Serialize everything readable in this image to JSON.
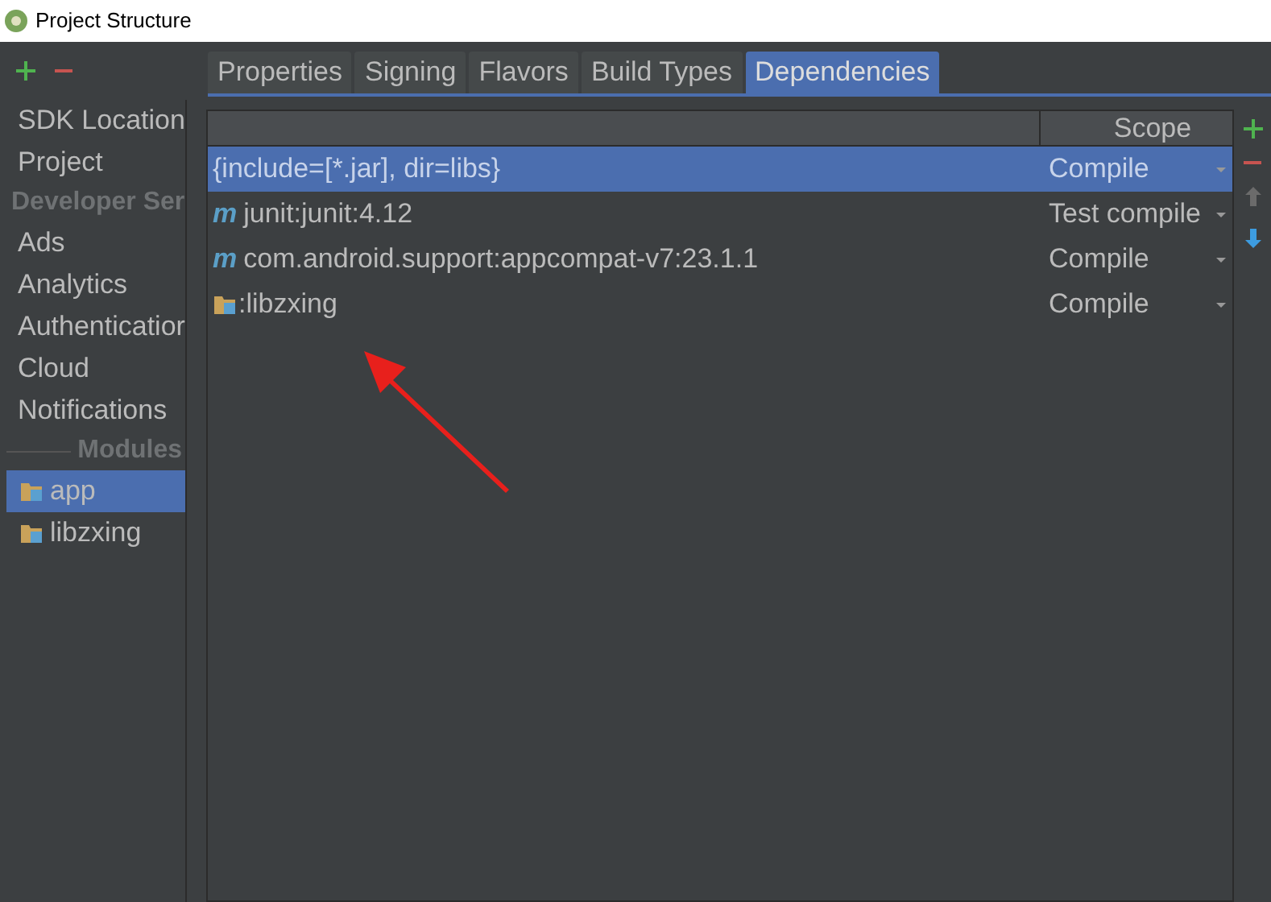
{
  "window": {
    "title": "Project Structure"
  },
  "sidebar": {
    "items": [
      {
        "kind": "item",
        "label": "SDK Location",
        "selected": false
      },
      {
        "kind": "item",
        "label": "Project",
        "selected": false
      },
      {
        "kind": "header",
        "label": "Developer Ser"
      },
      {
        "kind": "item",
        "label": "Ads",
        "selected": false
      },
      {
        "kind": "item",
        "label": "Analytics",
        "selected": false
      },
      {
        "kind": "item",
        "label": "Authenticatior",
        "selected": false
      },
      {
        "kind": "item",
        "label": "Cloud",
        "selected": false
      },
      {
        "kind": "item",
        "label": "Notifications",
        "selected": false
      },
      {
        "kind": "section",
        "label": "Modules"
      },
      {
        "kind": "module",
        "label": "app",
        "selected": true
      },
      {
        "kind": "module",
        "label": "libzxing",
        "selected": false
      }
    ]
  },
  "tabs": [
    {
      "label": "Properties",
      "selected": false
    },
    {
      "label": "Signing",
      "selected": false
    },
    {
      "label": "Flavors",
      "selected": false
    },
    {
      "label": "Build Types",
      "selected": false
    },
    {
      "label": "Dependencies",
      "selected": true
    }
  ],
  "table": {
    "columns": [
      "Scope"
    ],
    "rows": [
      {
        "kind": "files",
        "name": "{include=[*.jar], dir=libs}",
        "scope": "Compile",
        "selected": true
      },
      {
        "kind": "maven",
        "icon": "m",
        "name": "junit:junit:4.12",
        "scope": "Test compile",
        "selected": false
      },
      {
        "kind": "maven",
        "icon": "m",
        "name": "com.android.support:appcompat-v7:23.1.1",
        "scope": "Compile",
        "selected": false
      },
      {
        "kind": "module",
        "name": ":libzxing",
        "scope": "Compile",
        "selected": false
      }
    ]
  }
}
